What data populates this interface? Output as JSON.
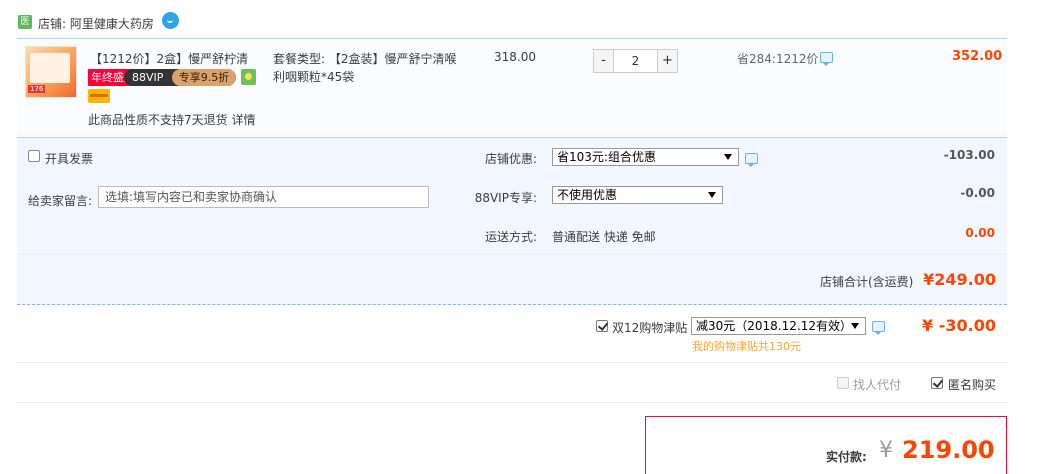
{
  "shop": {
    "icon_glyph": "医",
    "name": "店铺: 阿里健康大药房",
    "chat_icon": "wangwang-icon"
  },
  "item": {
    "title": "【1212价】2盒】慢严舒柠清喉...",
    "badge_red": "年终盛典",
    "badge_vip_left": "88VIP",
    "badge_vip_right": "专享9.5折",
    "thumb_tag": "176",
    "sku": "套餐类型: 【2盒装】慢严舒宁清喉利咽颗粒*45袋",
    "price": "318.00",
    "quantity": "2",
    "minus": "-",
    "plus": "+",
    "save": "省284:1212价",
    "subtotal": "352.00",
    "notice": "此商品性质不支持7天退货 详情"
  },
  "options": {
    "invoice_label": "开具发票",
    "message_label": "给卖家留言:",
    "message_placeholder": "选填:填写内容已和卖家协商确认",
    "shop_discount_label": "店铺优惠:",
    "shop_discount_value": "省103元:组合优惠",
    "shop_discount_amount": "-103.00",
    "vip_label": "88VIP专享:",
    "vip_value": "不使用优惠",
    "vip_amount": "-0.00",
    "shipping_label": "运送方式:",
    "shipping_value": "普通配送 快递 免邮",
    "shipping_amount": "0.00",
    "total_label": "店铺合计(含运费)",
    "total_amount": "¥249.00"
  },
  "subsidy": {
    "label": "双12购物津贴",
    "value": "减30元（2018.12.12有效）",
    "amount": "¥ -30.00",
    "note": "我的购物津贴共130元",
    "checked": true
  },
  "extras": {
    "proxy_label": "找人代付",
    "anon_label": "匿名购买"
  },
  "pay": {
    "label": "实付款:",
    "currency": "¥",
    "amount": "219.00"
  },
  "colors": {
    "accent": "#ff4400",
    "border_blue": "#b2d1ff",
    "option_bg": "#f2f7ff",
    "pay_border": "#ff0036",
    "subsidy_note": "#f0a830"
  }
}
